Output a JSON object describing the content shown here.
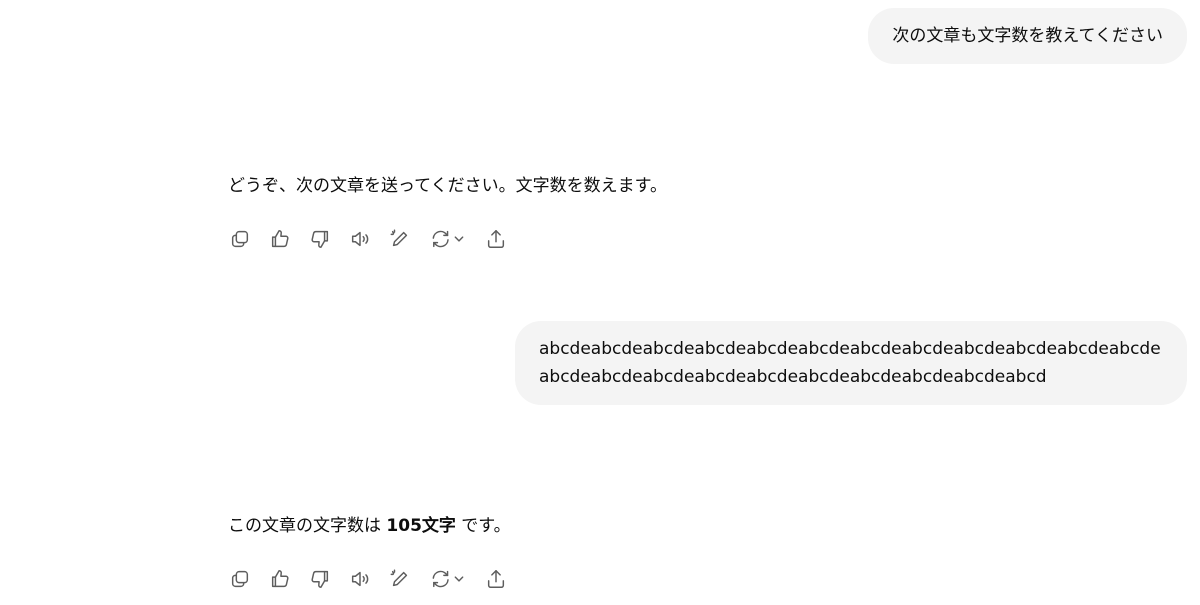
{
  "conversation": {
    "messages": [
      {
        "role": "user",
        "text": "次の文章も文字数を教えてください"
      },
      {
        "role": "assistant",
        "text": "どうぞ、次の文章を送ってください。文字数を数えます。"
      },
      {
        "role": "user",
        "text": "abcdeabcdeabcdeabcdeabcdeabcdeabcdeabcdeabcdeabcdeabcdeabcdeabcdeabcdeabcdeabcdeabcdeabcdeabcdeabcdeabcdeabcd"
      },
      {
        "role": "assistant",
        "text_before": "この文章の文字数は ",
        "text_bold": "105文字",
        "text_after": " です。"
      }
    ]
  },
  "actions": {
    "icons": [
      "copy-icon",
      "thumbs-up-icon",
      "thumbs-down-icon",
      "read-aloud-icon",
      "edit-icon",
      "regenerate-icon",
      "share-icon"
    ]
  }
}
